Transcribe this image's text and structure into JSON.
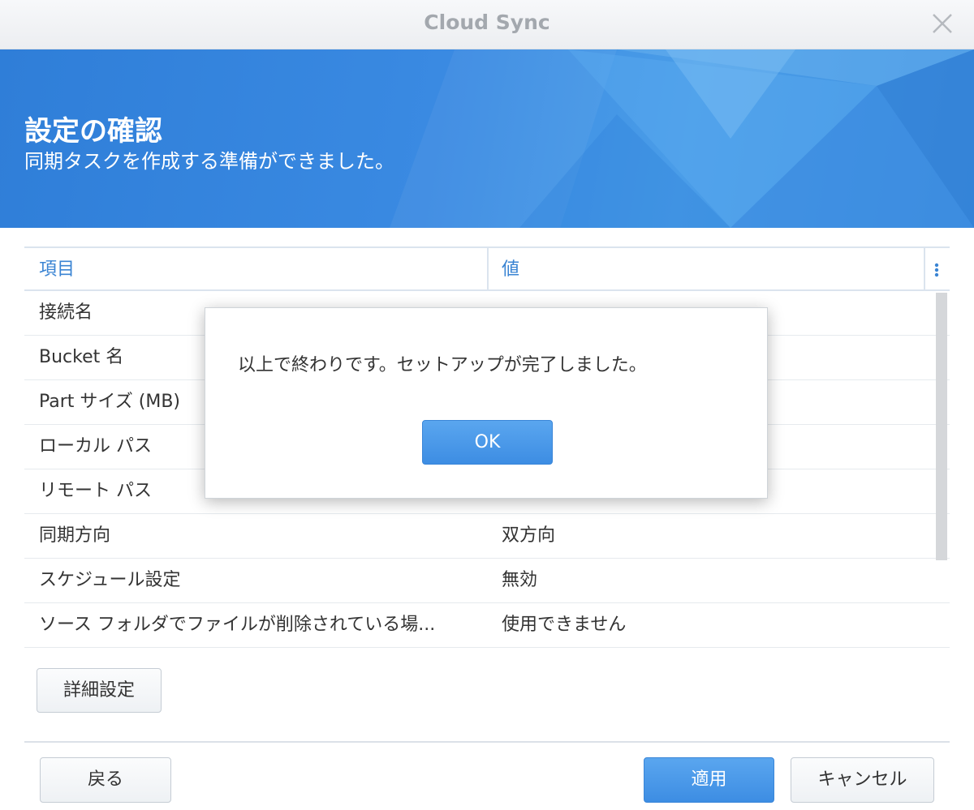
{
  "window": {
    "title": "Cloud Sync"
  },
  "header": {
    "heading": "設定の確認",
    "subheading": "同期タスクを作成する準備ができました。"
  },
  "grid": {
    "columns": [
      "項目",
      "値"
    ],
    "rows": [
      {
        "key": "接続名",
        "value": ""
      },
      {
        "key": "Bucket 名",
        "value": ""
      },
      {
        "key": "Part サイズ (MB)",
        "value": ""
      },
      {
        "key": "ローカル パス",
        "value": ""
      },
      {
        "key": "リモート パス",
        "value": ""
      },
      {
        "key": "同期方向",
        "value": "双方向"
      },
      {
        "key": "スケジュール設定",
        "value": "無効"
      },
      {
        "key": "ソース フォルダでファイルが削除されている場...",
        "value": "使用できません"
      }
    ]
  },
  "buttons": {
    "advanced": "詳細設定",
    "back": "戻る",
    "apply": "適用",
    "cancel": "キャンセル"
  },
  "dialog": {
    "message": "以上で終わりです。セットアップが完了しました。",
    "ok": "OK"
  },
  "colors": {
    "accent": "#3d8de3",
    "header_text": "#3a84d3"
  }
}
